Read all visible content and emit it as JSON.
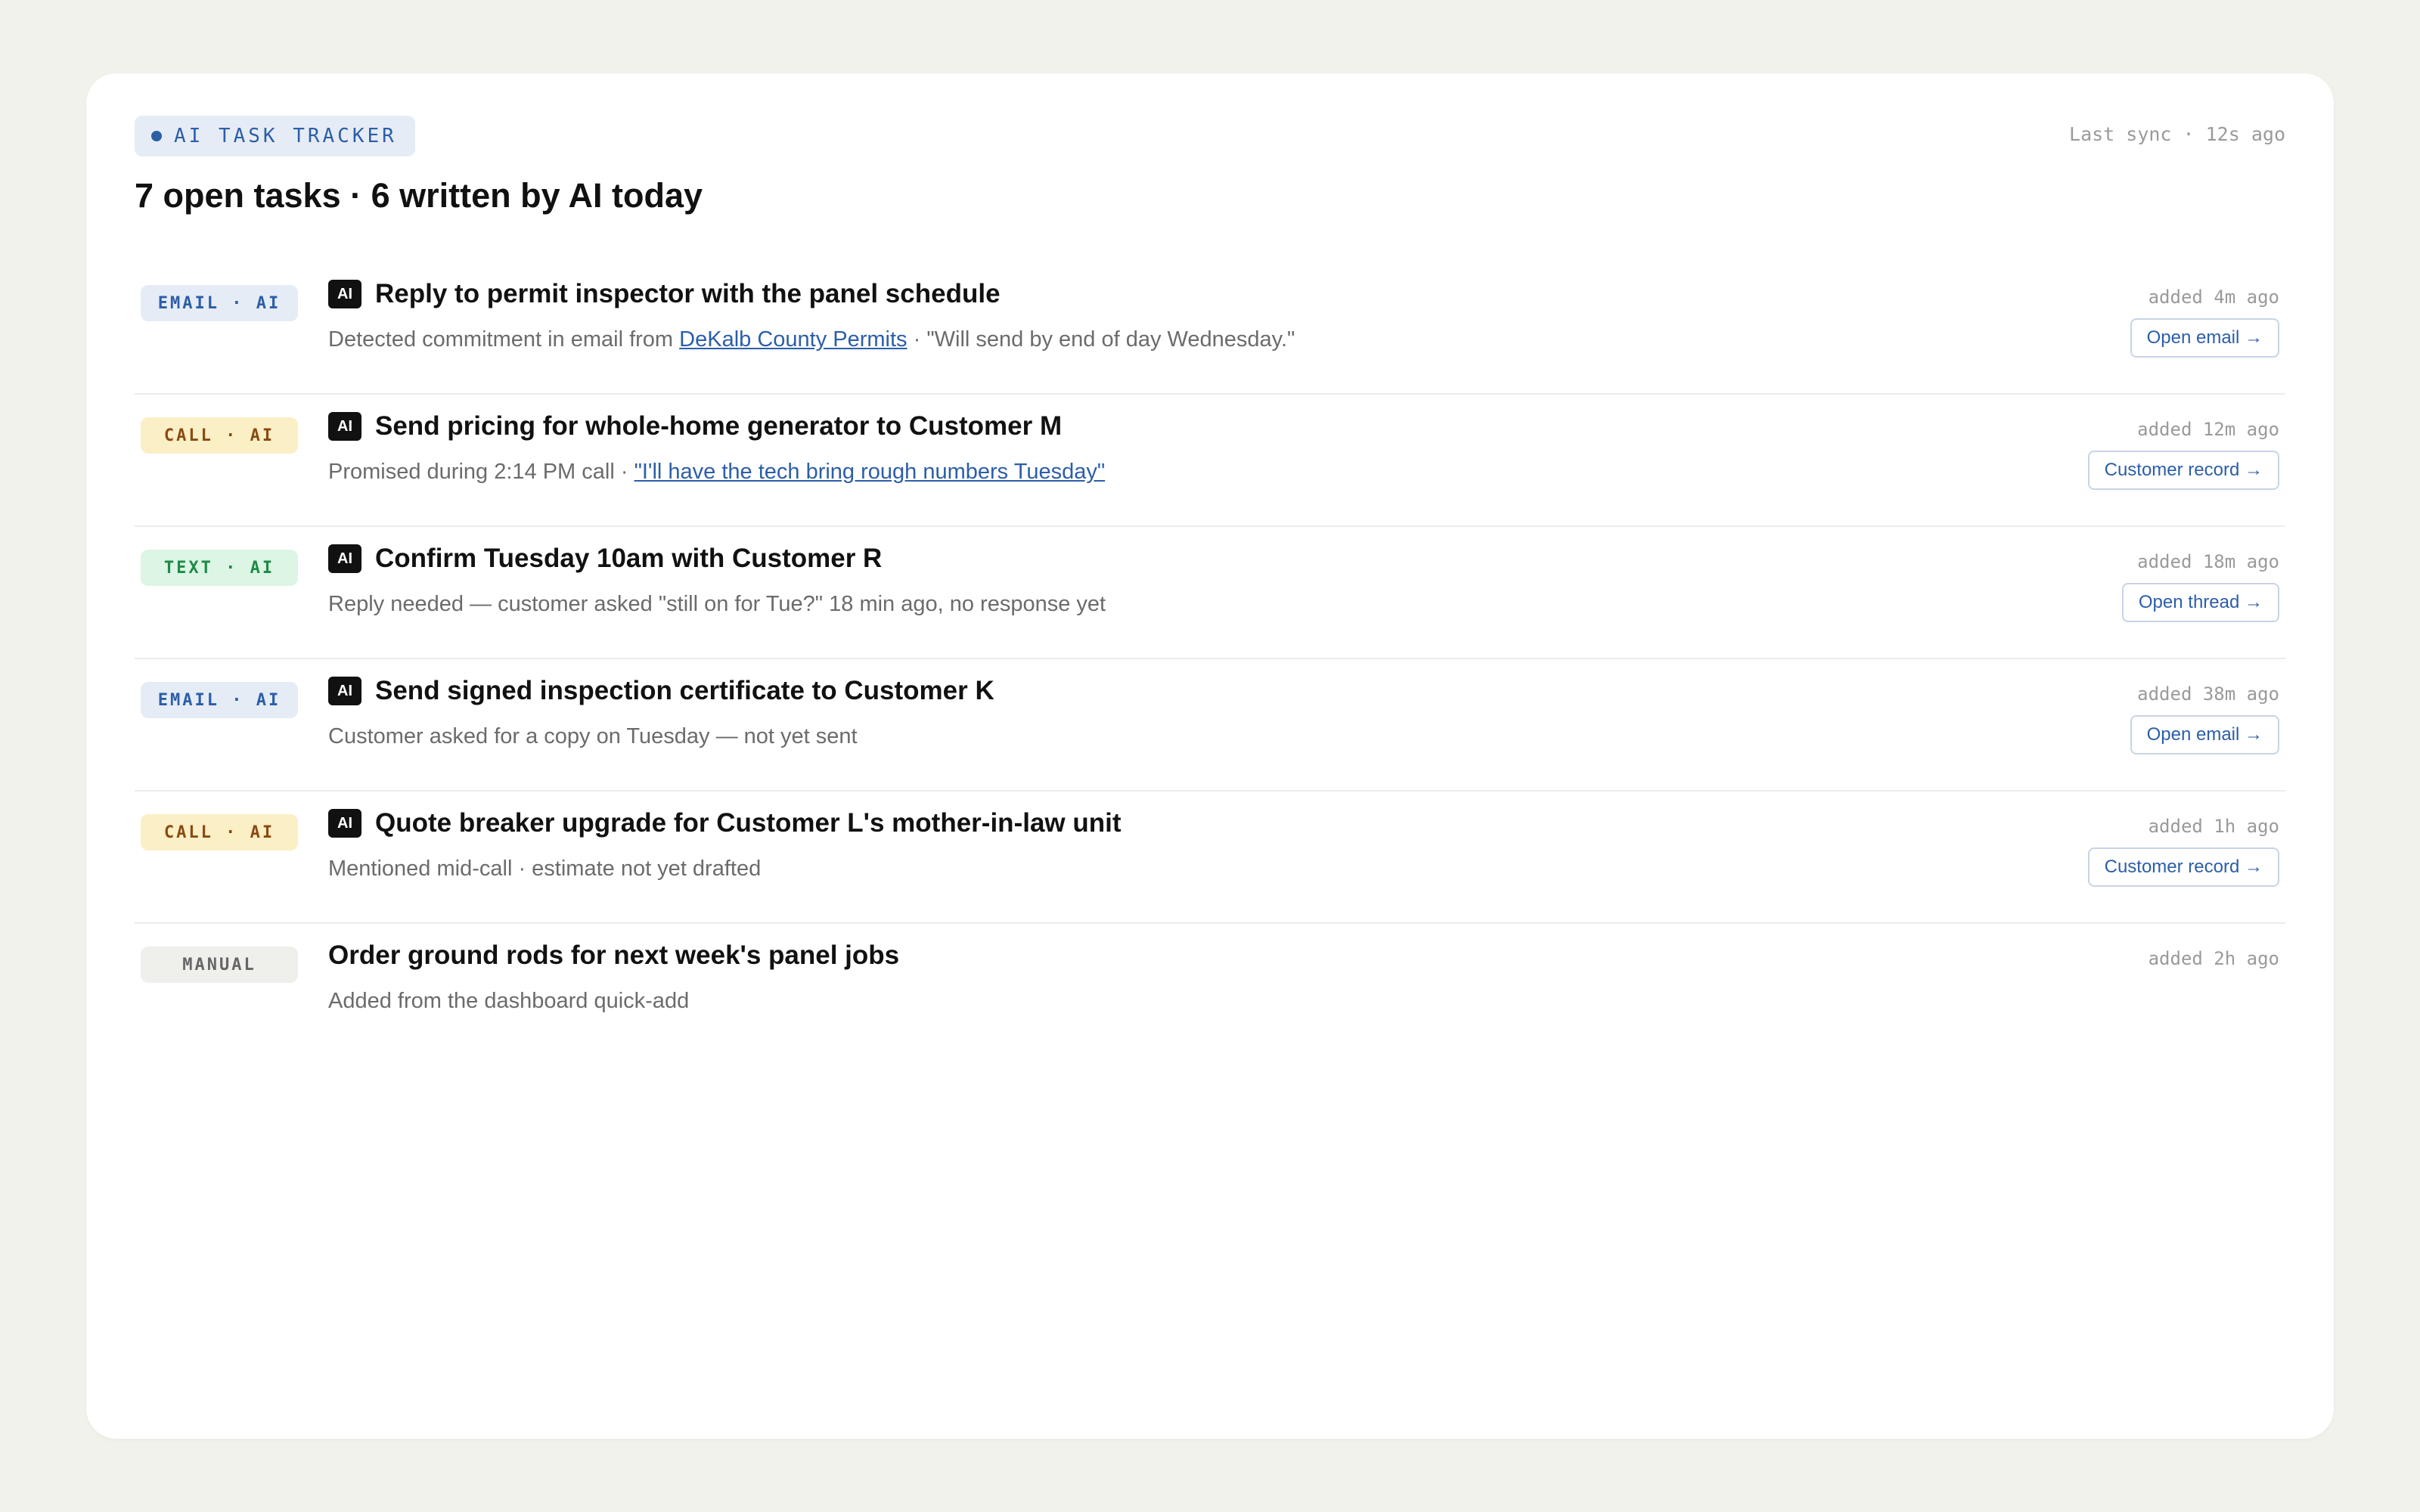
{
  "header": {
    "tag_label": "AI TASK TRACKER",
    "last_sync": "Last sync · 12s ago",
    "title": "7 open tasks · 6 written by AI today"
  },
  "colors": {
    "accent": "#2c5ea8",
    "email_bg": "#e6ecf5",
    "call_bg": "#fbefc6",
    "text_bg": "#dcf5e4",
    "manual_bg": "#efefec"
  },
  "tasks": [
    {
      "source": "EMAIL · AI",
      "ai_badge": "AI",
      "title": "Reply to permit inspector with the panel schedule",
      "desc_pre": "Detected commitment in email from ",
      "desc_link": "DeKalb County Permits",
      "desc_post": " · \"Will send by end of day Wednesday.\"",
      "added": "added 4m ago",
      "action": "Open email →"
    },
    {
      "source": "CALL · AI",
      "ai_badge": "AI",
      "title": "Send pricing for whole-home generator to Customer M",
      "desc_pre": "Promised during 2:14 PM call · ",
      "desc_link": "\"I'll have the tech bring rough numbers Tuesday\"",
      "desc_post": "",
      "added": "added 12m ago",
      "action": "Customer record →"
    },
    {
      "source": "TEXT · AI",
      "ai_badge": "AI",
      "title": "Confirm Tuesday 10am with Customer R",
      "desc": "Reply needed — customer asked \"still on for Tue?\" 18 min ago, no response yet",
      "added": "added 18m ago",
      "action": "Open thread →"
    },
    {
      "source": "EMAIL · AI",
      "ai_badge": "AI",
      "title": "Send signed inspection certificate to Customer K",
      "desc": "Customer asked for a copy on Tuesday — not yet sent",
      "added": "added 38m ago",
      "action": "Open email →"
    },
    {
      "source": "CALL · AI",
      "ai_badge": "AI",
      "title": "Quote breaker upgrade for Customer L's mother-in-law unit",
      "desc": "Mentioned mid-call · estimate not yet drafted",
      "added": "added 1h ago",
      "action": "Customer record →"
    },
    {
      "source": "MANUAL",
      "title": "Order ground rods for next week's panel jobs",
      "desc": "Added from the dashboard quick-add",
      "added": "added 2h ago"
    }
  ]
}
